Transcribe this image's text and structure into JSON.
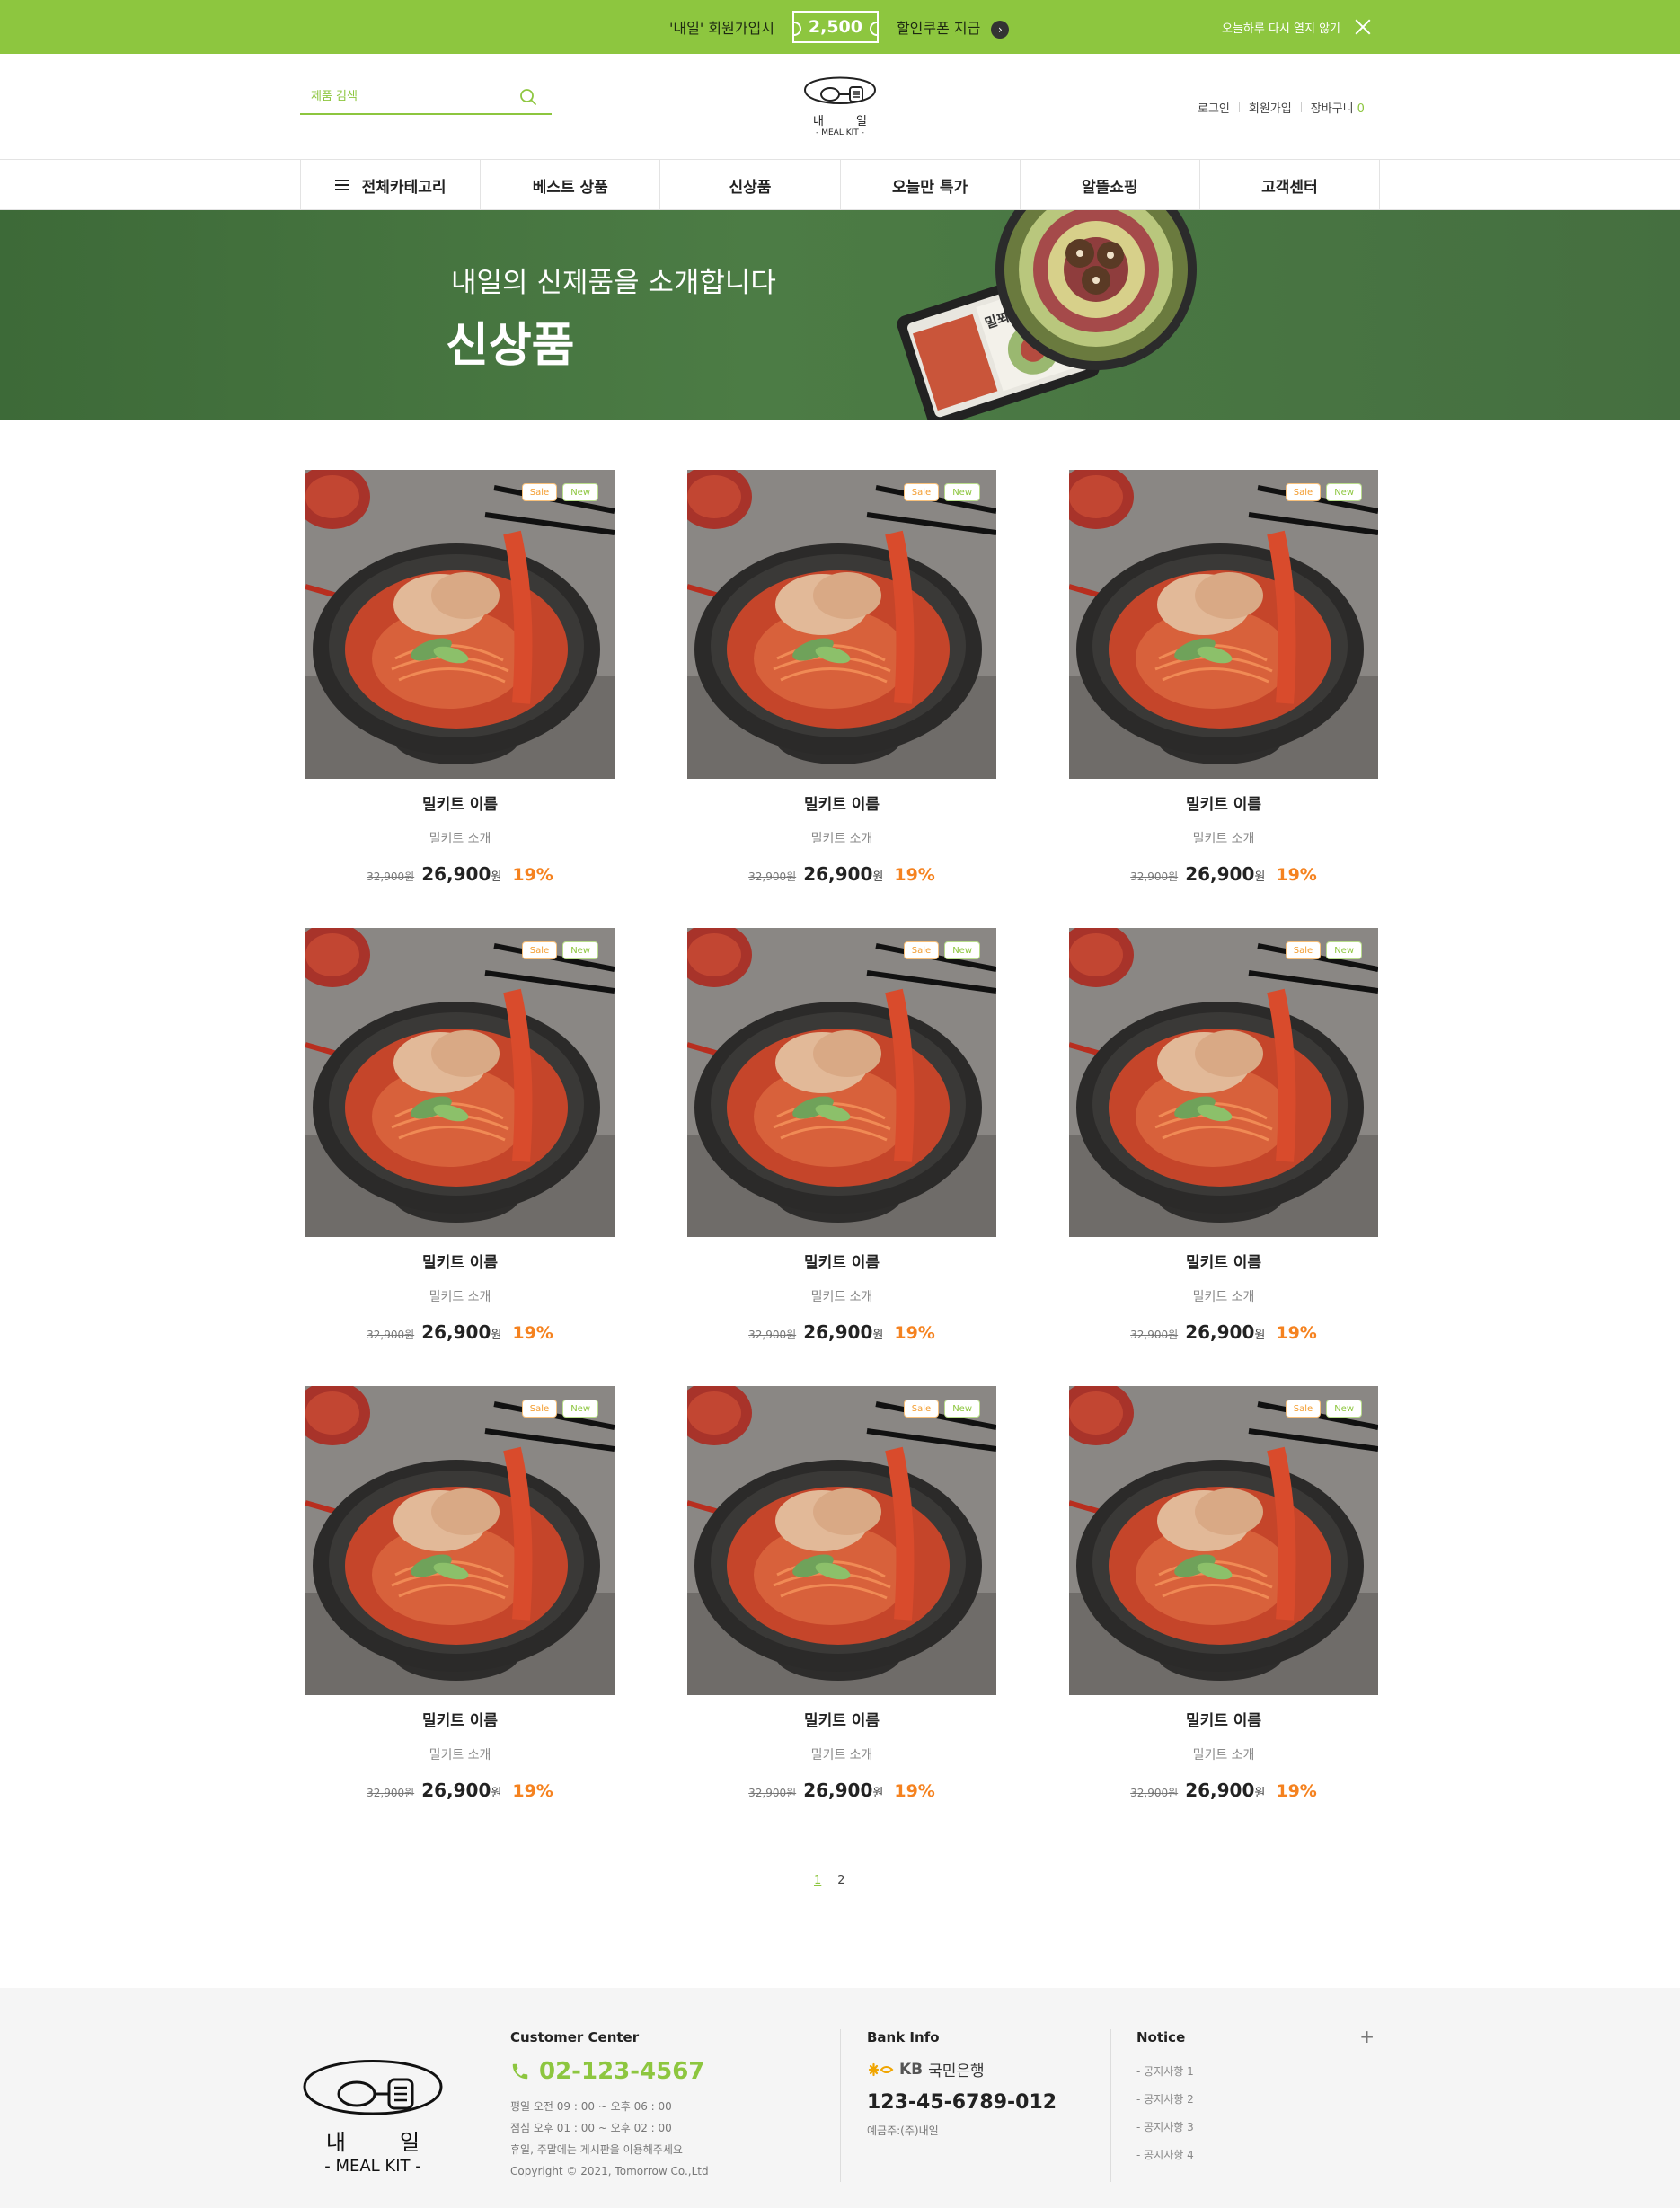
{
  "topbar": {
    "promo_before": "'내일' 회원가입시",
    "coupon_amount": "2,500",
    "promo_after": "할인쿠폰 지급",
    "promo_arrow_icon": "chevron-right-icon",
    "dismiss_text": "오늘하루 다시 열지 않기",
    "close_icon": "close-icon"
  },
  "header": {
    "search_placeholder": "제품 검색",
    "search_icon": "search-icon",
    "logo": {
      "korean_left": "내",
      "korean_right": "일",
      "english": "- MEAL KIT -"
    },
    "util": {
      "login": "로그인",
      "signup": "회원가입",
      "cart": "장바구니",
      "cart_count": "0"
    }
  },
  "nav": {
    "items": [
      {
        "label": "전체카테고리",
        "icon": "hamburger-icon"
      },
      {
        "label": "베스트 상품"
      },
      {
        "label": "신상품"
      },
      {
        "label": "오늘만 특가"
      },
      {
        "label": "알뜰쇼핑"
      },
      {
        "label": "고객센터"
      }
    ]
  },
  "banner": {
    "subtitle": "내일의 신제품을 소개합니다",
    "title": "신상품",
    "package_label": "밀푀유나베"
  },
  "products": [
    {
      "name": "밀키트 이름",
      "desc": "밀키트 소개",
      "orig_price": "32,900원",
      "price": "26,900",
      "won": "원",
      "discount": "19%",
      "badges": [
        "Sale",
        "New"
      ]
    },
    {
      "name": "밀키트 이름",
      "desc": "밀키트 소개",
      "orig_price": "32,900원",
      "price": "26,900",
      "won": "원",
      "discount": "19%",
      "badges": [
        "Sale",
        "New"
      ]
    },
    {
      "name": "밀키트 이름",
      "desc": "밀키트 소개",
      "orig_price": "32,900원",
      "price": "26,900",
      "won": "원",
      "discount": "19%",
      "badges": [
        "Sale",
        "New"
      ]
    },
    {
      "name": "밀키트 이름",
      "desc": "밀키트 소개",
      "orig_price": "32,900원",
      "price": "26,900",
      "won": "원",
      "discount": "19%",
      "badges": [
        "Sale",
        "New"
      ]
    },
    {
      "name": "밀키트 이름",
      "desc": "밀키트 소개",
      "orig_price": "32,900원",
      "price": "26,900",
      "won": "원",
      "discount": "19%",
      "badges": [
        "Sale",
        "New"
      ]
    },
    {
      "name": "밀키트 이름",
      "desc": "밀키트 소개",
      "orig_price": "32,900원",
      "price": "26,900",
      "won": "원",
      "discount": "19%",
      "badges": [
        "Sale",
        "New"
      ]
    },
    {
      "name": "밀키트 이름",
      "desc": "밀키트 소개",
      "orig_price": "32,900원",
      "price": "26,900",
      "won": "원",
      "discount": "19%",
      "badges": [
        "Sale",
        "New"
      ]
    },
    {
      "name": "밀키트 이름",
      "desc": "밀키트 소개",
      "orig_price": "32,900원",
      "price": "26,900",
      "won": "원",
      "discount": "19%",
      "badges": [
        "Sale",
        "New"
      ]
    },
    {
      "name": "밀키트 이름",
      "desc": "밀키트 소개",
      "orig_price": "32,900원",
      "price": "26,900",
      "won": "원",
      "discount": "19%",
      "badges": [
        "Sale",
        "New"
      ]
    }
  ],
  "pagination": {
    "pages": [
      "1",
      "2"
    ],
    "current": "1"
  },
  "footer": {
    "logo": {
      "korean_left": "내",
      "korean_right": "일",
      "english": "- MEAL KIT -"
    },
    "customer_center": {
      "title": "Customer Center",
      "phone": "02-123-4567",
      "phone_icon": "phone-icon",
      "lines": [
        "평일 오전 09 : 00 ~ 오후 06 : 00",
        "점심 오후 01 : 00 ~ 오후 02 : 00",
        "휴일, 주말에는 게시판을 이용해주세요",
        "Copyright © 2021, Tomorrow Co.,Ltd"
      ]
    },
    "bank": {
      "title": "Bank Info",
      "bank_name": "국민은행",
      "bank_prefix": "KB",
      "bank_icon": "kb-star-icon",
      "account": "123-45-6789-012",
      "holder": "예금주:(주)내일"
    },
    "notice": {
      "title": "Notice",
      "more_icon": "plus-icon",
      "items": [
        "- 공지사항 1",
        "- 공지사항 2",
        "- 공지사항 3",
        "- 공지사항 4"
      ]
    }
  },
  "colors": {
    "brand_green": "#8dc63f",
    "banner_green": "#4c7c45",
    "discount_orange": "#f5821f"
  }
}
